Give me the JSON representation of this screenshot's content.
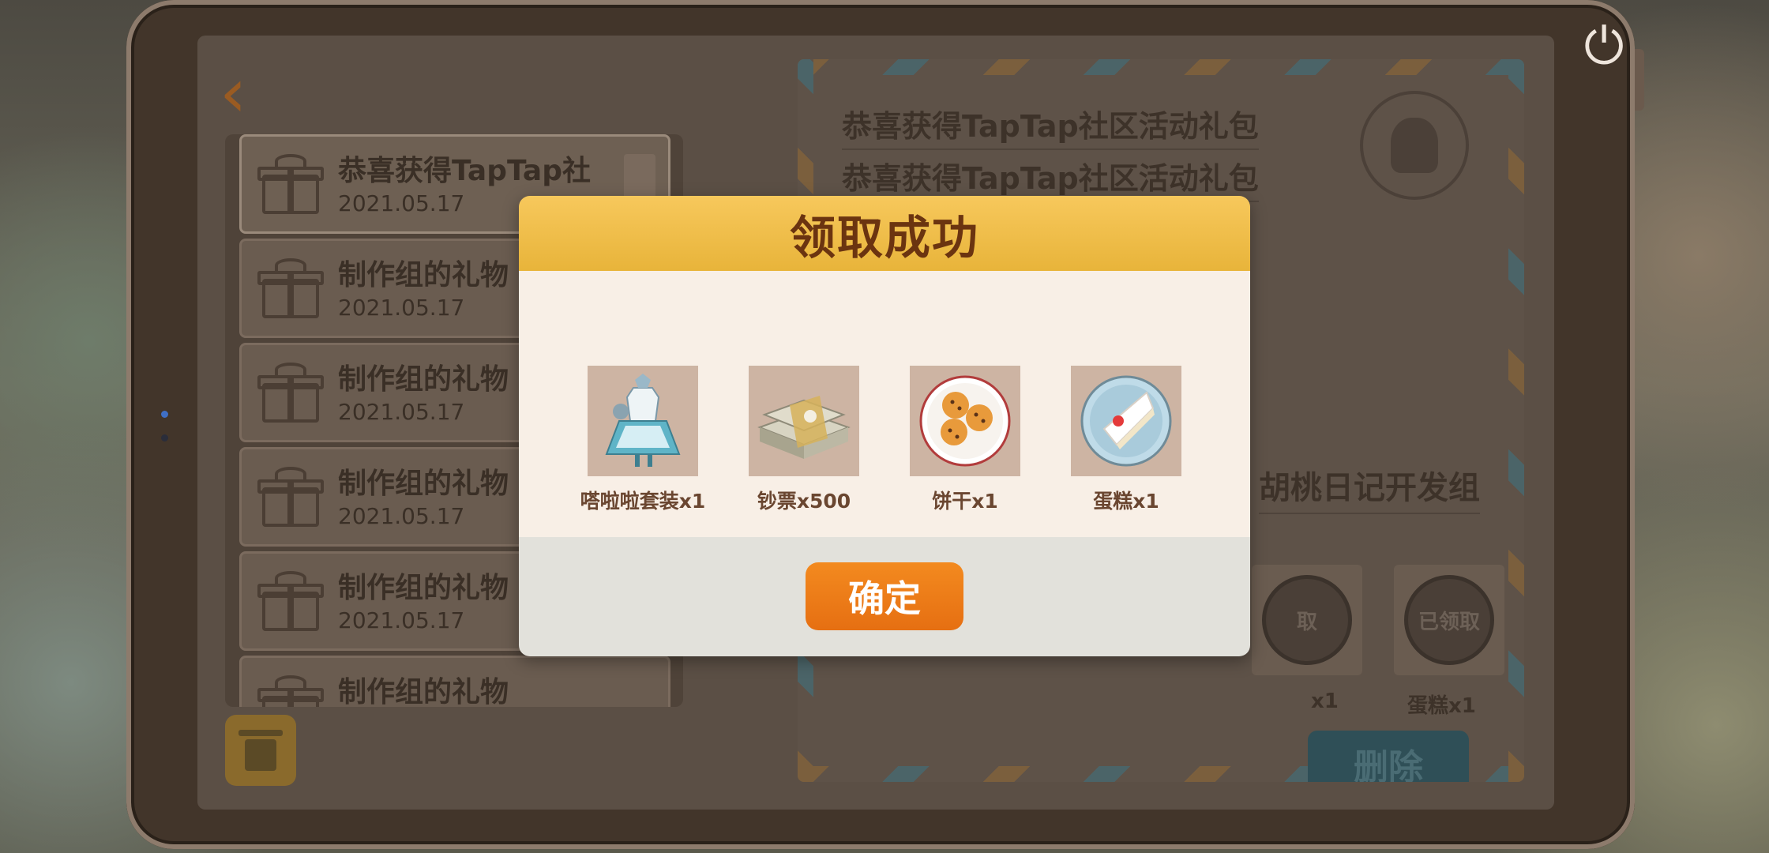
{
  "dialog": {
    "title": "领取成功",
    "rewards": [
      {
        "label": "嗒啦啦套装x1",
        "icon": "outfit-icon"
      },
      {
        "label": "钞票x500",
        "icon": "cash-stack-icon"
      },
      {
        "label": "饼干x1",
        "icon": "cookies-icon"
      },
      {
        "label": "蛋糕x1",
        "icon": "cake-slice-icon"
      }
    ],
    "confirm_label": "确定"
  },
  "mail_list": {
    "items": [
      {
        "title": "恭喜获得TapTap社",
        "date": "2021.05.17"
      },
      {
        "title": "制作组的礼物",
        "date": "2021.05.17"
      },
      {
        "title": "制作组的礼物",
        "date": "2021.05.17"
      },
      {
        "title": "制作组的礼物",
        "date": "2021.05.17"
      },
      {
        "title": "制作组的礼物",
        "date": "2021.05.17"
      },
      {
        "title": "制作组的礼物",
        "date": ""
      }
    ]
  },
  "letter": {
    "title_line1": "恭喜获得TapTap社区活动礼包",
    "title_line2": "恭喜获得TapTap社区活动礼包",
    "signature": "胡桃日记开发组",
    "received_badge": "已领取",
    "received_badge_partial": "取",
    "received_label_partial": "x1",
    "received_label": "蛋糕x1",
    "delete_label": "删除"
  },
  "colors": {
    "header_gold": "#f7c85c",
    "title_brown": "#6b3410",
    "confirm_orange": "#f38a1f"
  }
}
